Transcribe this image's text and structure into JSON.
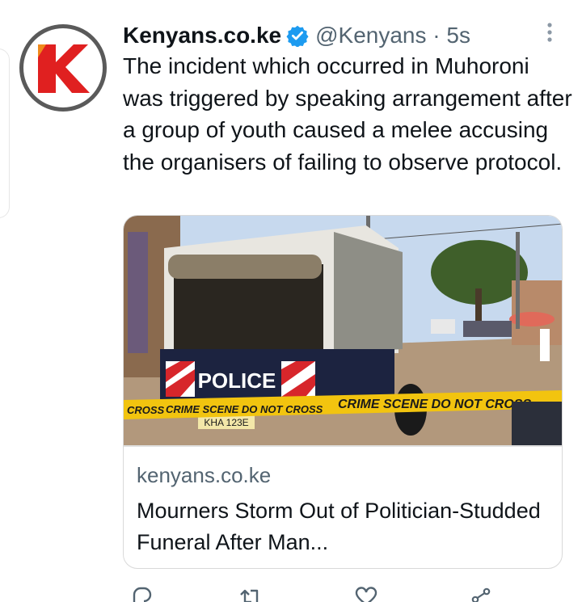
{
  "tweet": {
    "display_name": "Kenyans.co.ke",
    "handle_time": "@Kenyans · 5s",
    "text": "The incident which occurred in Muhoroni was triggered by speaking arrangement after a group of youth caused a melee accusing the organisers of failing to observe protocol."
  },
  "card": {
    "domain": "kenyans.co.ke",
    "title": "Mourners Storm Out of Politician-Studded Funeral After Man...",
    "image_texts": {
      "police": "POLICE",
      "tape_left": "CRIME SCENE DO NOT CROSS",
      "tape_right": "CRIME SCENE DO NOT CROSS",
      "tape_stub": "CROSS",
      "plate": "KHA 123E"
    }
  },
  "icons": [
    "kenyans-logo-icon",
    "verified-badge-icon",
    "more-options-icon",
    "reply-icon",
    "retweet-icon",
    "like-icon",
    "share-icon"
  ],
  "colors": {
    "brand_red": "#e02020",
    "verified_blue": "#1d9bf0",
    "secondary_text": "#536471",
    "tape_yellow": "#f2c40f"
  }
}
